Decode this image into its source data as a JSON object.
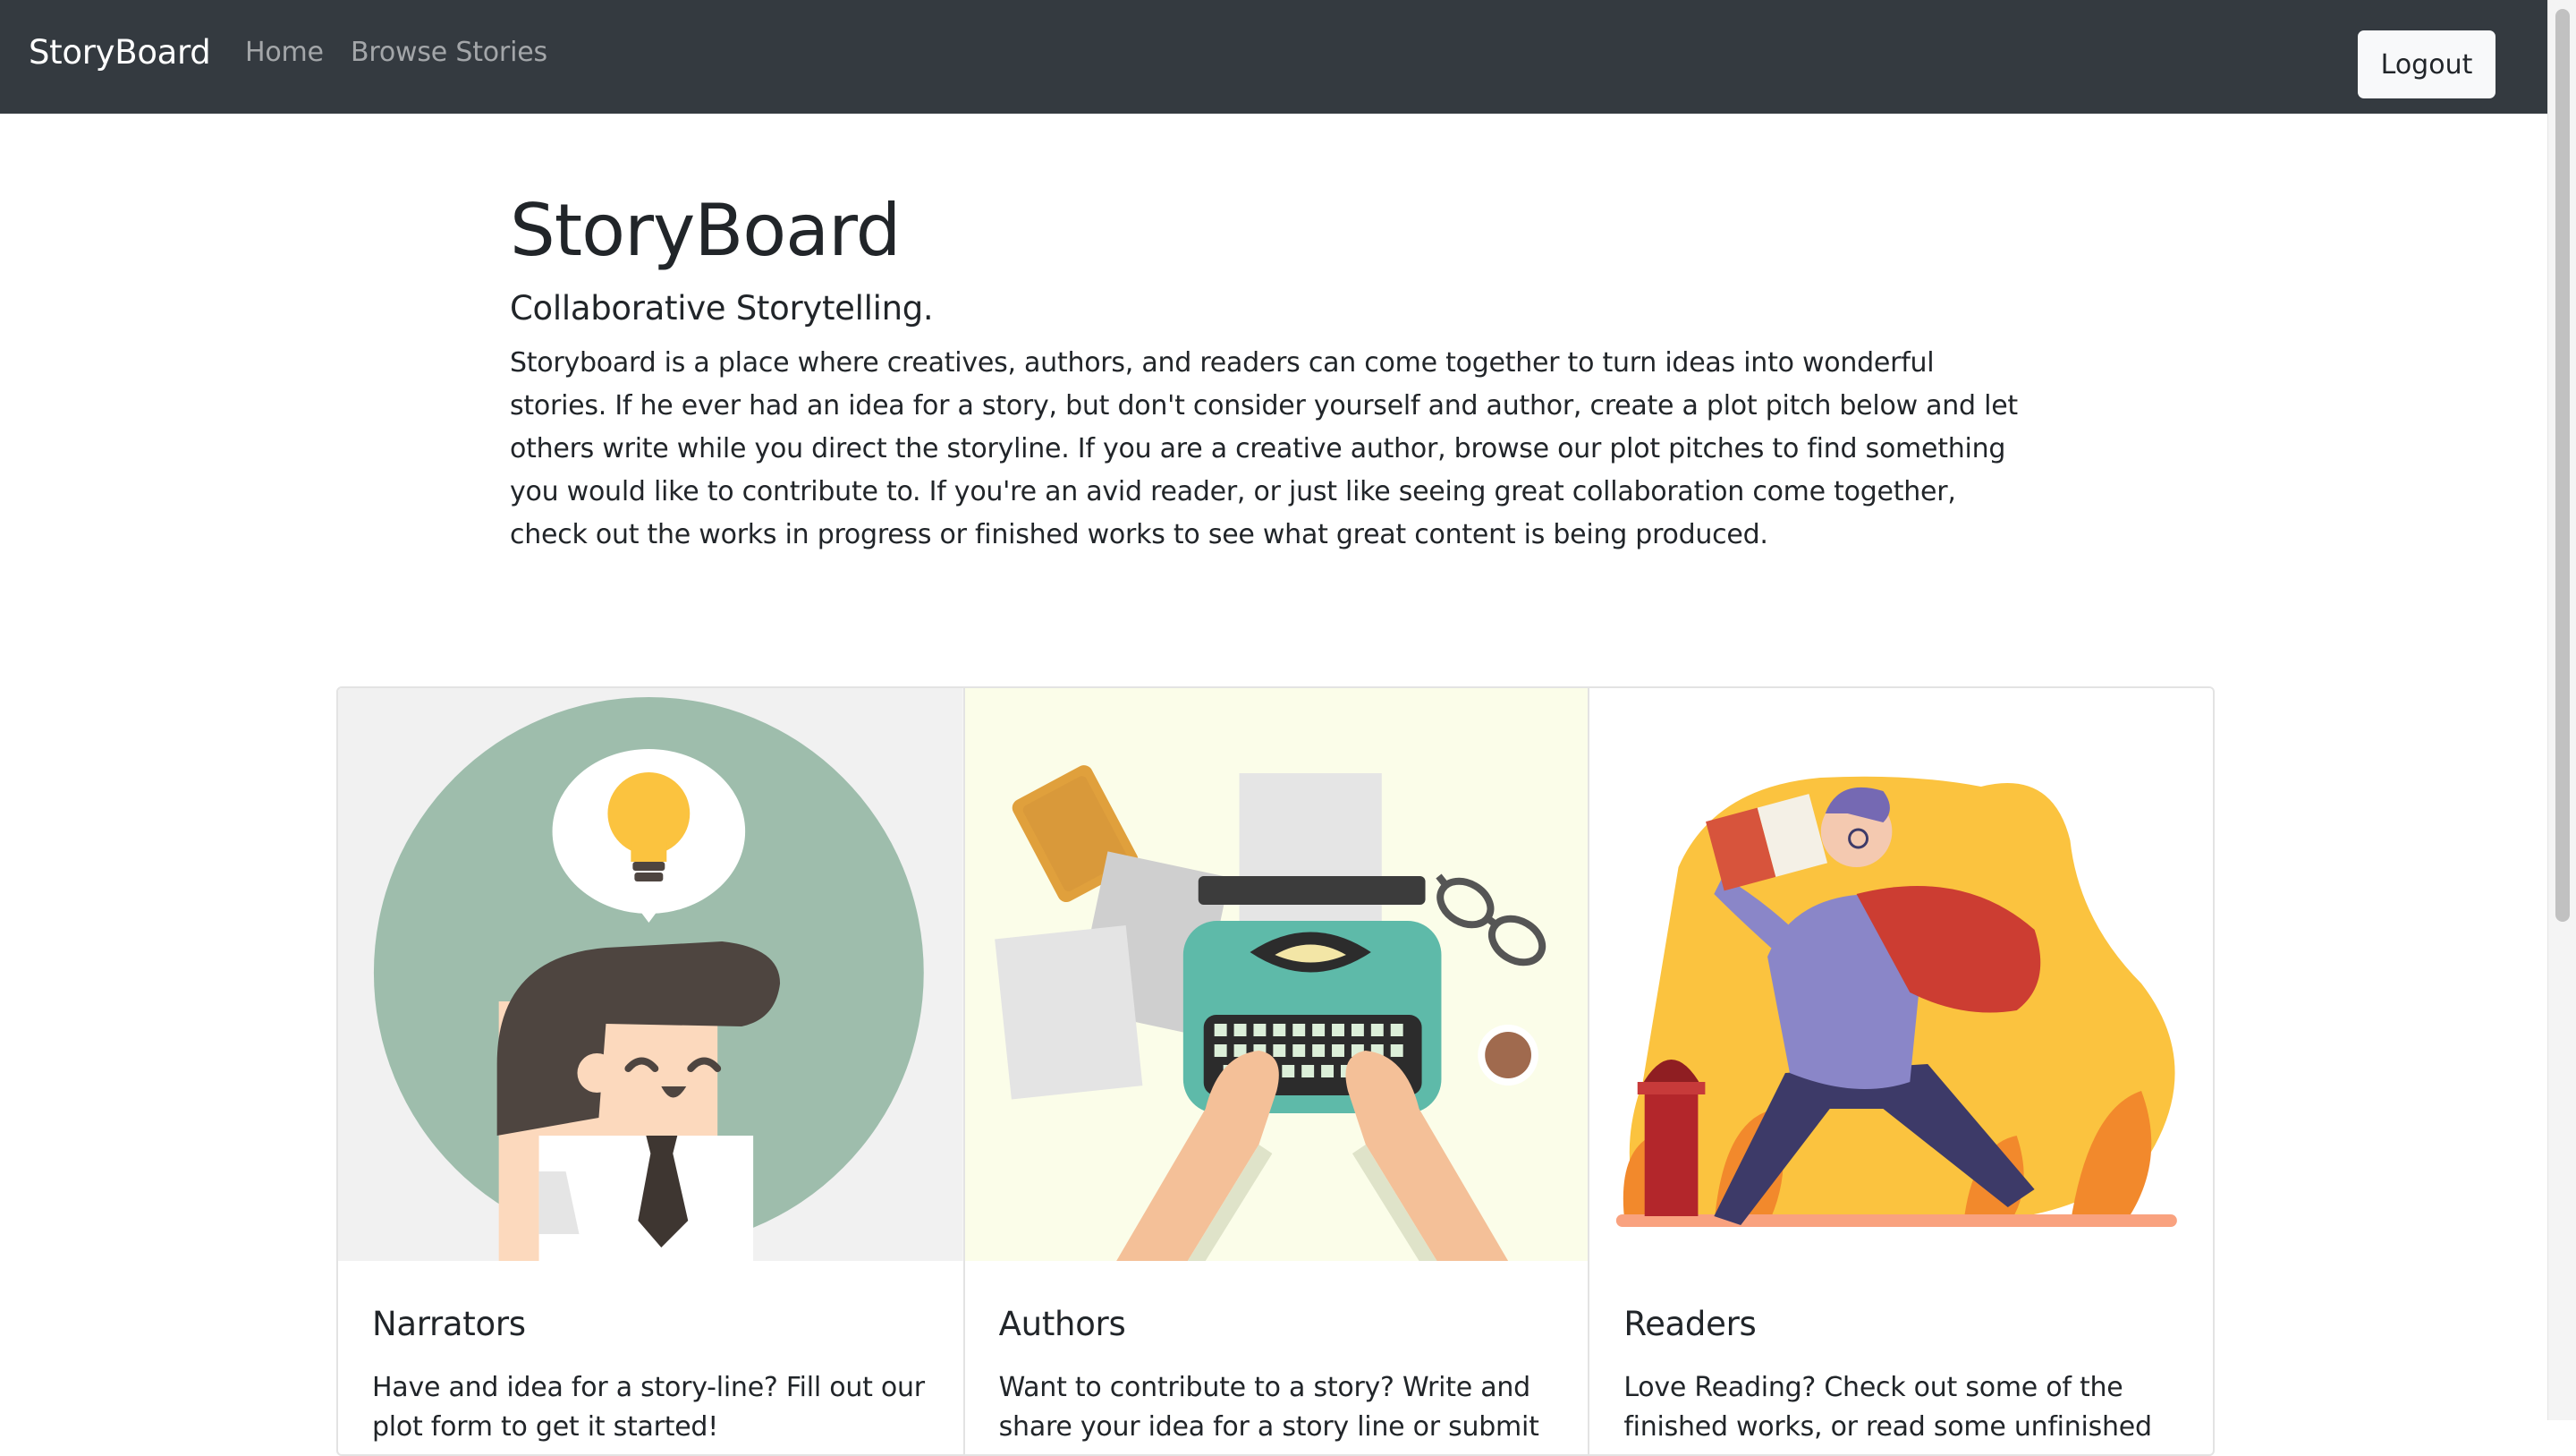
{
  "navbar": {
    "brand": "StoryBoard",
    "links": [
      "Home",
      "Browse Stories"
    ],
    "logout_label": "Logout"
  },
  "hero": {
    "title": "StoryBoard",
    "subtitle": "Collaborative Storytelling.",
    "description": "Storyboard is a place where creatives, authors, and readers can come together to turn ideas into wonderful stories. If he ever had an idea for a story, but don't consider yourself and author, create a plot pitch below and let others write while you direct the storyline. If you are a creative author, browse our plot pitches to find something you would like to contribute to. If you're an avid reader, or just like seeing great collaboration come together, check out the works in progress or finished works to see what great content is being produced."
  },
  "cards": [
    {
      "title": "Narrators",
      "text": "Have and idea for a story-line? Fill out our plot form to get it started!",
      "illustration": "narrator-lightbulb-illustration"
    },
    {
      "title": "Authors",
      "text": "Want to contribute to a story? Write and share your idea for a story line or submit",
      "illustration": "typewriter-illustration"
    },
    {
      "title": "Readers",
      "text": "Love Reading? Check out some of the finished works, or read some unfinished",
      "illustration": "reader-walking-illustration"
    }
  ],
  "colors": {
    "navbar": "#343a40",
    "narrator_bg": "#f1f1f1",
    "authors_bg": "#fbfde9",
    "readers_bg": "#ffffff",
    "accent_yellow": "#fbc33f"
  }
}
